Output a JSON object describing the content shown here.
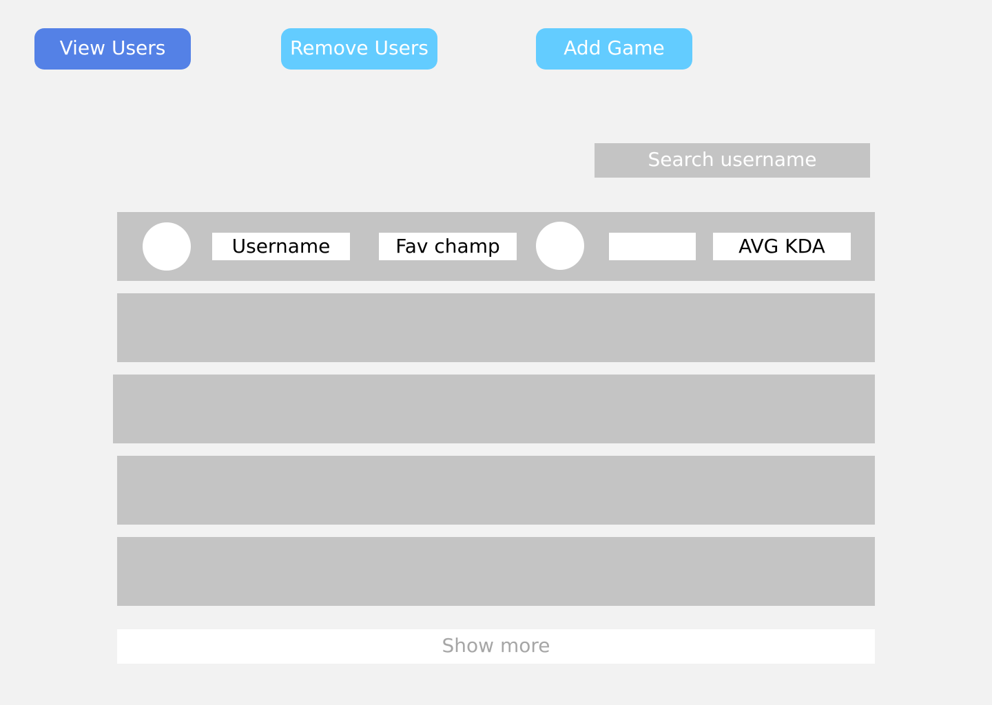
{
  "nav": {
    "view_users": "View Users",
    "remove_users": "Remove Users",
    "add_game": "Add Game"
  },
  "search": {
    "placeholder": "Search username"
  },
  "table": {
    "header": {
      "username": "Username",
      "fav_champ": "Fav champ",
      "blank": "",
      "avg_kda": "AVG KDA"
    }
  },
  "footer": {
    "show_more": "Show more"
  },
  "colors": {
    "active_button": "#5481e6",
    "button": "#63ccff",
    "placeholder_block": "#c4c4c4",
    "background": "#f2f2f2"
  }
}
